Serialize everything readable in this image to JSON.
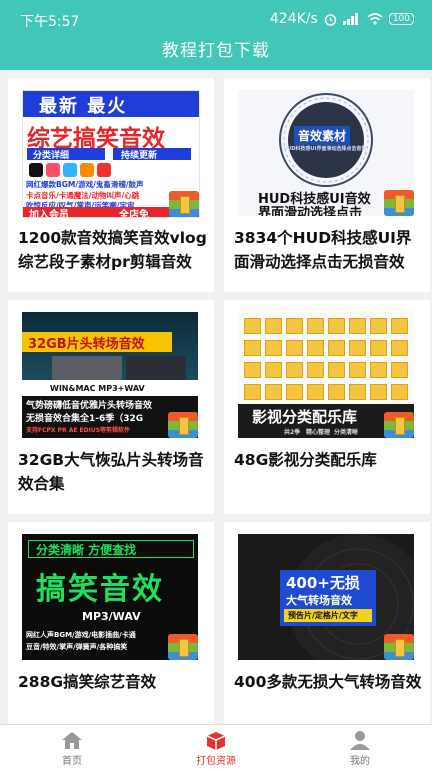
{
  "status": {
    "time": "下午5:57",
    "speed": "424K/s",
    "battery": "100"
  },
  "header": {
    "title": "教程打包下载"
  },
  "cards": [
    {
      "title": "1200款音效搞笑音效vlog综艺段子素材pr剪辑音效",
      "thumb": {
        "line1": "最新 最火",
        "line2": "综艺搞笑音效",
        "tag1": "分类详细",
        "tag2": "持续更新",
        "row1": "网红爆款BGM/游戏/鬼畜滑稽/鼓声",
        "row2": "卡点音乐/卡通魔法/动物叫声/心跳",
        "row3": "吃惊反应/叹气/掌声/运笑喇/宇宙",
        "footer1": "加入会员",
        "footer2": "全店免"
      }
    },
    {
      "title": "3834个HUD科技感UI界面滑动选择点击无损音效",
      "thumb": {
        "badge": "音效素材",
        "sub": "HUD科技感UI界面滑动选择点击音效",
        "caption1": "HUD科技感UI音效",
        "caption2": "界面滑动选择点击"
      }
    },
    {
      "title": "32GB大气恢弘片头转场音效合集",
      "thumb": {
        "banner": "32GB片头转场音效",
        "format": "WIN&MAC MP3+WAV",
        "line1": "气势磅礴低音优雅片头转场音效",
        "line2": "无损音效合集全1-6季（32G",
        "line3": "支持FCPX PR AE EDIUS等剪辑软件"
      }
    },
    {
      "title": "48G影视分类配乐库",
      "thumb": {
        "banner": "影视分类配乐库",
        "sub1": "共2季",
        "sub2": "精心整理",
        "sub3": "分类清晰"
      }
    },
    {
      "title": "288G搞笑综艺音效",
      "thumb": {
        "top": "分类清晰 方便查找",
        "main": "搞笑音效",
        "sub": "MP3/WAV",
        "row1": "网红人声BGM/游戏/电影插曲/卡通",
        "row2": "豆音/特效/掌声/弹簧声/各种搞笑"
      }
    },
    {
      "title": "400多款无损大气转场音效",
      "thumb": {
        "main": "400+无损",
        "sub": "大气转场音效",
        "tags": "预告片/定格片/文字"
      }
    }
  ],
  "tabs": [
    {
      "label": "首页",
      "icon": "home-icon"
    },
    {
      "label": "打包资源",
      "icon": "package-icon"
    },
    {
      "label": "我的",
      "icon": "user-icon"
    }
  ],
  "colors": {
    "header": "#40c7b8",
    "active_tab": "#e0342c",
    "background": "#f1f1f1"
  }
}
